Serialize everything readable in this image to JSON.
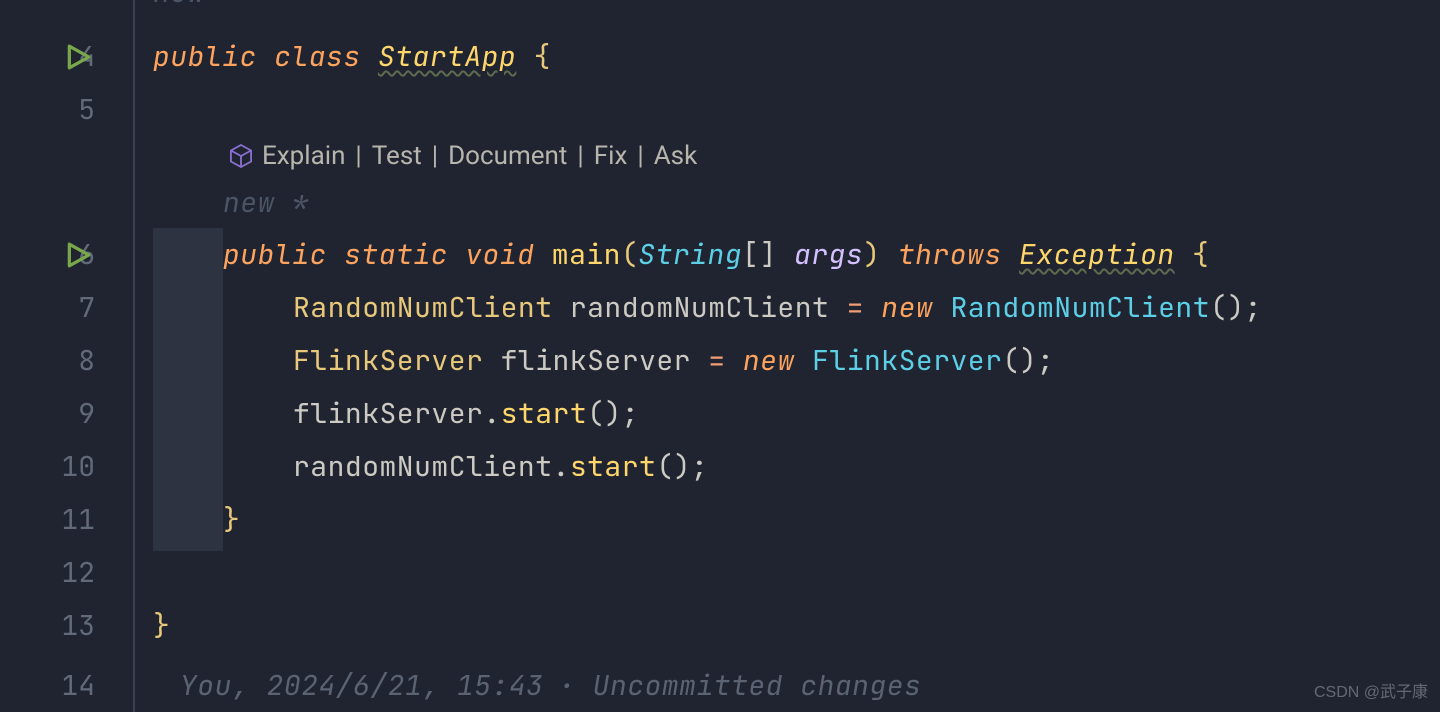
{
  "gutter": {
    "lines": [
      {
        "num": "4",
        "run": true
      },
      {
        "num": "5",
        "run": false
      },
      {
        "num": "6",
        "run": true
      },
      {
        "num": "7",
        "run": false
      },
      {
        "num": "8",
        "run": false
      },
      {
        "num": "9",
        "run": false
      },
      {
        "num": "10",
        "run": false
      },
      {
        "num": "11",
        "run": false
      },
      {
        "num": "12",
        "run": false
      },
      {
        "num": "13",
        "run": false
      },
      {
        "num": "14",
        "run": false
      }
    ],
    "colors": {
      "run_icon": "#5f913a"
    }
  },
  "hints": {
    "new_star_top": "new *",
    "new_star_mid": "new *"
  },
  "codelens": {
    "items": [
      "Explain",
      "Test",
      "Document",
      "Fix",
      "Ask"
    ],
    "separator": "|"
  },
  "code": {
    "l4": {
      "kw_public": "public",
      "kw_class": "class",
      "classname": "StartApp",
      "brace_open": "{"
    },
    "l6": {
      "kw_public": "public",
      "kw_static": "static",
      "kw_void": "void",
      "m_main": "main",
      "paren_open": "(",
      "type_string": "String",
      "brackets": "[]",
      "param_args": "args",
      "paren_close": ")",
      "kw_throws": "throws",
      "exc": "Exception",
      "brace_open": "{"
    },
    "l7": {
      "type": "RandomNumClient",
      "var": "randomNumClient",
      "eq": "=",
      "kw_new": "new",
      "ctor": "RandomNumClient",
      "tail": "();"
    },
    "l8": {
      "type": "FlinkServer",
      "var": "flinkServer",
      "eq": "=",
      "kw_new": "new",
      "ctor": "FlinkServer",
      "tail": "();"
    },
    "l9": {
      "var": "flinkServer",
      "dot": ".",
      "call": "start",
      "tail": "();"
    },
    "l10": {
      "var": "randomNumClient",
      "dot": ".",
      "call": "start",
      "tail": "();"
    },
    "l11": {
      "brace_close": "}"
    },
    "l13": {
      "brace_close": "}"
    }
  },
  "blame": {
    "author": "You,",
    "date": "2024/6/21,",
    "time": "15:43",
    "dot": "·",
    "status": "Uncommitted changes"
  },
  "watermark": "CSDN @武子康"
}
